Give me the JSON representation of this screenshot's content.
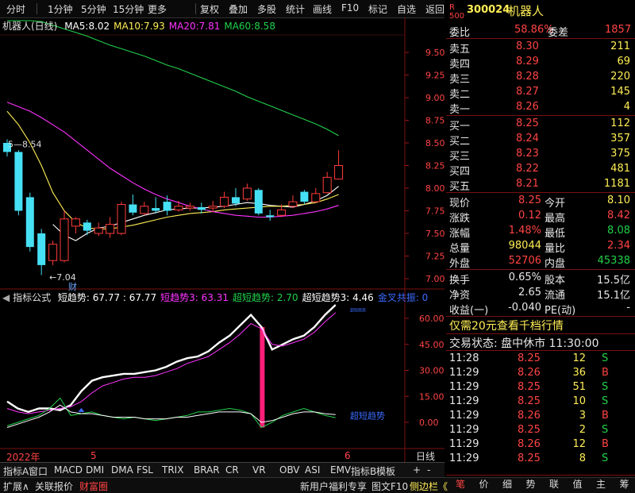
{
  "toolbar": {
    "items": [
      "分时",
      "1分钟",
      "5分钟",
      "15分钟",
      "更多",
      "复权",
      "叠加",
      "多股",
      "统计",
      "画线",
      "F10",
      "标记",
      "自选",
      "返回"
    ]
  },
  "main_chart": {
    "title": "机器人(日线)",
    "legend": [
      {
        "label": "MA5:",
        "value": "8.02",
        "color": "#ffffff"
      },
      {
        "label": "MA10:",
        "value": "7.93",
        "color": "#ffee55"
      },
      {
        "label": "MA20:",
        "value": "7.81",
        "color": "#ff33ff"
      },
      {
        "label": "MA60:",
        "value": "8.58",
        "color": "#21d24b"
      }
    ],
    "price_ticks": [
      "9.50",
      "9.25",
      "9.00",
      "8.75",
      "8.50",
      "8.25",
      "8.00",
      "7.75",
      "7.50",
      "7.25",
      "7.00"
    ],
    "annotations": {
      "high_label": "8.54",
      "low_label": "7.04",
      "news_label": "财"
    }
  },
  "indicator": {
    "name": "指标公式",
    "legend": [
      {
        "text": "短趋势: 67.77 : 67.77",
        "color": "#ffffff"
      },
      {
        "text": "短趋势3: 63.31",
        "color": "#ff33ff"
      },
      {
        "text": "超短趋势: 2.70",
        "color": "#21d24b"
      },
      {
        "text": "超短趋势3: 4.46",
        "color": "#ffffff"
      },
      {
        "text": "金叉共振: 0",
        "color": "#3a6bff"
      }
    ],
    "ticks": [
      "60.00",
      "45.00",
      "30.00",
      "15.00",
      "0.00"
    ],
    "tag_label": "超短趋势",
    "tiny_label": "超短趋势"
  },
  "x_axis": {
    "year_label": "2022年",
    "month_labels": [
      "5",
      "6"
    ],
    "period": "日线"
  },
  "chart_data": [
    {
      "type": "candlestick",
      "title": "机器人(日线)",
      "ylim": [
        7.0,
        9.6
      ],
      "candles": [
        {
          "o": 8.5,
          "c": 8.4,
          "h": 8.54,
          "l": 8.35
        },
        {
          "o": 8.4,
          "c": 7.75,
          "h": 8.42,
          "l": 7.7
        },
        {
          "o": 7.9,
          "c": 7.35,
          "h": 7.95,
          "l": 7.3
        },
        {
          "o": 7.5,
          "c": 7.15,
          "h": 7.55,
          "l": 7.04
        },
        {
          "o": 7.2,
          "c": 7.38,
          "h": 7.42,
          "l": 7.15
        },
        {
          "o": 7.2,
          "c": 7.66,
          "h": 7.75,
          "l": 7.18
        },
        {
          "o": 7.58,
          "c": 7.66,
          "h": 7.68,
          "l": 7.5
        },
        {
          "o": 7.62,
          "c": 7.53,
          "h": 7.65,
          "l": 7.48
        },
        {
          "o": 7.5,
          "c": 7.56,
          "h": 7.62,
          "l": 7.47
        },
        {
          "o": 7.5,
          "c": 7.6,
          "h": 7.68,
          "l": 7.45
        },
        {
          "o": 7.5,
          "c": 7.82,
          "h": 7.85,
          "l": 7.48
        },
        {
          "o": 7.82,
          "c": 7.73,
          "h": 7.93,
          "l": 7.7
        },
        {
          "o": 7.72,
          "c": 7.8,
          "h": 7.85,
          "l": 7.7
        },
        {
          "o": 7.78,
          "c": 7.75,
          "h": 7.9,
          "l": 7.72
        },
        {
          "o": 7.85,
          "c": 7.75,
          "h": 7.92,
          "l": 7.7
        },
        {
          "o": 7.76,
          "c": 7.8,
          "h": 7.86,
          "l": 7.74
        },
        {
          "o": 7.78,
          "c": 7.8,
          "h": 7.84,
          "l": 7.75
        },
        {
          "o": 7.79,
          "c": 7.76,
          "h": 7.84,
          "l": 7.72
        },
        {
          "o": 7.78,
          "c": 7.8,
          "h": 7.86,
          "l": 7.74
        },
        {
          "o": 7.8,
          "c": 7.9,
          "h": 7.96,
          "l": 7.78
        },
        {
          "o": 7.9,
          "c": 7.83,
          "h": 8.0,
          "l": 7.8
        },
        {
          "o": 7.88,
          "c": 8.0,
          "h": 8.05,
          "l": 7.86
        },
        {
          "o": 7.98,
          "c": 7.72,
          "h": 8.0,
          "l": 7.7
        },
        {
          "o": 7.7,
          "c": 7.68,
          "h": 7.76,
          "l": 7.64
        },
        {
          "o": 7.7,
          "c": 7.76,
          "h": 7.82,
          "l": 7.68
        },
        {
          "o": 7.8,
          "c": 7.85,
          "h": 7.92,
          "l": 7.78
        },
        {
          "o": 7.96,
          "c": 7.85,
          "h": 7.98,
          "l": 7.82
        },
        {
          "o": 7.85,
          "c": 7.94,
          "h": 8.0,
          "l": 7.84
        },
        {
          "o": 7.95,
          "c": 8.12,
          "h": 8.18,
          "l": 7.94
        },
        {
          "o": 8.1,
          "c": 8.25,
          "h": 8.42,
          "l": 8.1
        }
      ],
      "series": [
        {
          "name": "MA5",
          "color": "#ffffff",
          "values": [
            null,
            null,
            null,
            null,
            7.6,
            7.48,
            7.42,
            7.5,
            7.56,
            7.58,
            7.62,
            7.66,
            7.7,
            7.73,
            7.76,
            7.77,
            7.78,
            7.78,
            7.79,
            7.8,
            7.82,
            7.84,
            7.83,
            7.81,
            7.8,
            7.79,
            7.82,
            7.86,
            7.92,
            8.02
          ]
        },
        {
          "name": "MA10",
          "color": "#ffee55",
          "values": [
            8.85,
            8.7,
            8.5,
            8.25,
            7.95,
            7.75,
            7.62,
            7.56,
            7.55,
            7.55,
            7.57,
            7.59,
            7.62,
            7.65,
            7.68,
            7.7,
            7.72,
            7.73,
            7.74,
            7.76,
            7.77,
            7.78,
            7.79,
            7.8,
            7.8,
            7.81,
            7.82,
            7.84,
            7.88,
            7.93
          ]
        },
        {
          "name": "MA20",
          "color": "#ff33ff",
          "values": [
            8.95,
            8.9,
            8.85,
            8.78,
            8.7,
            8.62,
            8.52,
            8.42,
            8.32,
            8.22,
            8.14,
            8.06,
            7.99,
            7.93,
            7.88,
            7.84,
            7.8,
            7.77,
            7.74,
            7.72,
            7.7,
            7.69,
            7.68,
            7.68,
            7.69,
            7.7,
            7.72,
            7.74,
            7.77,
            7.81
          ]
        },
        {
          "name": "MA60",
          "color": "#21d24b",
          "values": [
            9.95,
            9.92,
            9.88,
            9.84,
            9.8,
            9.76,
            9.72,
            9.68,
            9.63,
            9.58,
            9.54,
            9.5,
            9.46,
            9.41,
            9.36,
            9.32,
            9.27,
            9.22,
            9.17,
            9.12,
            9.07,
            9.01,
            8.96,
            8.91,
            8.86,
            8.81,
            8.76,
            8.71,
            8.65,
            8.58
          ]
        }
      ]
    },
    {
      "type": "line",
      "ylim": [
        -10,
        70
      ],
      "series": [
        {
          "name": "短趋势",
          "color": "#ffffff",
          "values": [
            12,
            8,
            6,
            8,
            8,
            7,
            10,
            18,
            24,
            26,
            27,
            28,
            28,
            29,
            30,
            32,
            35,
            37,
            38,
            41,
            46,
            50,
            56,
            62,
            55,
            42,
            45,
            48,
            50,
            55,
            62,
            67.77
          ]
        },
        {
          "name": "短趋势3",
          "color": "#ff33ff",
          "values": [
            8,
            6,
            5,
            6,
            7,
            8,
            9,
            12,
            17,
            21,
            23,
            25,
            26,
            26,
            27,
            29,
            31,
            34,
            36,
            38,
            42,
            46,
            51,
            57,
            54,
            45,
            44,
            46,
            48,
            52,
            58,
            63.31
          ]
        },
        {
          "name": "超短趋势",
          "color": "#21d24b",
          "values": [
            -2,
            0,
            2,
            4,
            8,
            14,
            4,
            5,
            6,
            4,
            3,
            2,
            3,
            2,
            1,
            2,
            3,
            4,
            6,
            6,
            7,
            8,
            7,
            5,
            -3,
            0,
            4,
            6,
            8,
            6,
            4,
            2.7
          ]
        },
        {
          "name": "超短趋势3",
          "color": "#ffffff",
          "values": [
            -3,
            -1,
            1,
            3,
            6,
            10,
            6,
            5,
            5,
            4,
            3,
            3,
            3,
            2,
            2,
            2,
            3,
            3,
            4,
            5,
            6,
            6,
            6,
            5,
            0,
            1,
            3,
            5,
            6,
            6,
            5,
            4.46
          ]
        },
        {
          "name": "金叉共振",
          "color": "#3a6bff",
          "values": [
            0,
            0,
            0,
            0,
            0,
            0,
            0,
            6,
            0,
            0,
            0,
            0,
            0,
            0,
            0,
            0,
            0,
            0,
            0,
            0,
            0,
            0,
            0,
            0,
            0,
            0,
            0,
            0,
            0,
            0,
            0,
            0
          ]
        }
      ],
      "bar_marker": {
        "index": 24,
        "from": -3,
        "to": 55,
        "color": "#ff1f7a"
      }
    }
  ],
  "quote": {
    "code": "300024",
    "name": "机器人",
    "weibi_label": "委比",
    "weibi": "58.86%",
    "weicha_label": "委差",
    "weicha": "1857",
    "asks": [
      {
        "label": "卖五",
        "price": "8.30",
        "vol": "211"
      },
      {
        "label": "卖四",
        "price": "8.29",
        "vol": "69"
      },
      {
        "label": "卖三",
        "price": "8.28",
        "vol": "220"
      },
      {
        "label": "卖二",
        "price": "8.27",
        "vol": "145"
      },
      {
        "label": "卖一",
        "price": "8.26",
        "vol": "4"
      }
    ],
    "bids": [
      {
        "label": "买一",
        "price": "8.25",
        "vol": "112"
      },
      {
        "label": "买二",
        "price": "8.24",
        "vol": "357"
      },
      {
        "label": "买三",
        "price": "8.23",
        "vol": "375"
      },
      {
        "label": "买四",
        "price": "8.22",
        "vol": "481"
      },
      {
        "label": "买五",
        "price": "8.21",
        "vol": "1181"
      }
    ],
    "stats": [
      {
        "l1": "现价",
        "v1": "8.25",
        "c1": "red",
        "l2": "今开",
        "v2": "8.10",
        "c2": "yellow"
      },
      {
        "l1": "涨跌",
        "v1": "0.12",
        "c1": "red",
        "l2": "最高",
        "v2": "8.42",
        "c2": "red"
      },
      {
        "l1": "涨幅",
        "v1": "1.48%",
        "c1": "red",
        "l2": "最低",
        "v2": "8.08",
        "c2": "green"
      },
      {
        "l1": "总量",
        "v1": "98044",
        "c1": "yellow",
        "l2": "量比",
        "v2": "2.34",
        "c2": "red"
      },
      {
        "l1": "外盘",
        "v1": "52706",
        "c1": "red",
        "l2": "内盘",
        "v2": "45338",
        "c2": "green"
      }
    ],
    "stats2": [
      {
        "l1": "换手",
        "v1": "0.65%",
        "l2": "股本",
        "v2": "15.5亿"
      },
      {
        "l1": "净资",
        "v1": "2.65",
        "l2": "流通",
        "v2": "15.1亿"
      },
      {
        "l1": "收益(一)",
        "v1": "-0.040",
        "l2": "PE(动)",
        "v2": "-"
      }
    ],
    "promo": "仅需20元查看千档行情",
    "trade_status": "交易状态: 盘中休市 11:30:00",
    "ticks": [
      {
        "t": "11:28",
        "p": "8.25",
        "v": "12",
        "s": "S"
      },
      {
        "t": "11:29",
        "p": "8.26",
        "v": "36",
        "s": "B"
      },
      {
        "t": "11:29",
        "p": "8.25",
        "v": "51",
        "s": "S"
      },
      {
        "t": "11:29",
        "p": "8.25",
        "v": "10",
        "s": "S"
      },
      {
        "t": "11:29",
        "p": "8.26",
        "v": "3",
        "s": "B"
      },
      {
        "t": "11:29",
        "p": "8.25",
        "v": "2",
        "s": "S"
      },
      {
        "t": "11:29",
        "p": "8.26",
        "v": "12",
        "s": "B"
      },
      {
        "t": "11:29",
        "p": "8.25",
        "v": "8",
        "s": "S"
      }
    ],
    "tabs": [
      "笔",
      "价",
      "细",
      "势",
      "联",
      "值",
      "主",
      "筹"
    ]
  },
  "indicator_tabs": [
    "指标A",
    "窗口",
    "MACD",
    "DMI",
    "DMA",
    "FSL",
    "TRIX",
    "BRAR",
    "CR",
    "VR",
    "OBV",
    "ASI",
    "EMV",
    "指标B",
    "模板"
  ],
  "status": {
    "left": [
      "扩展∧",
      "关联报价",
      "财富圈"
    ],
    "right": [
      "新用户福利专享",
      "图文F10",
      "侧边栏《"
    ]
  }
}
